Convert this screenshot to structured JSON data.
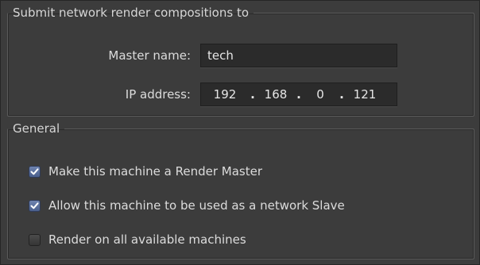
{
  "groups": {
    "submit": {
      "title": "Submit network render compositions to",
      "master_name_label": "Master name:",
      "master_name_value": "tech",
      "ip_label": "IP address:",
      "ip": [
        "192",
        "168",
        "0",
        "121"
      ]
    },
    "general": {
      "title": "General",
      "options": [
        {
          "label": "Make this machine a Render Master",
          "checked": true
        },
        {
          "label": "Allow this machine to be used as a network Slave",
          "checked": true
        },
        {
          "label": "Render on all available machines",
          "checked": false
        }
      ]
    }
  }
}
